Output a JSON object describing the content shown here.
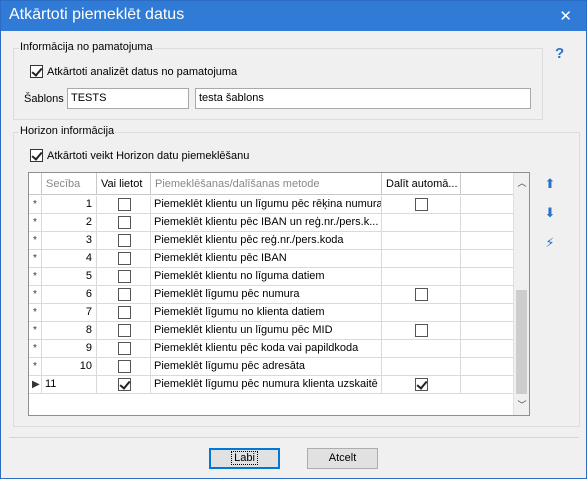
{
  "window": {
    "title": "Atkārtoti piemeklēt datus",
    "close_glyph": "✕"
  },
  "basis_group": {
    "caption": "Informācija no pamatojuma",
    "reanalyze_checkbox_label": "Atkārtoti analizēt datus no pamatojuma",
    "reanalyze_checked": true,
    "template_label": "Šablons",
    "template_code": "TESTS",
    "template_name": "testa šablons"
  },
  "horizon_group": {
    "caption": "Horizon informācija",
    "redo_checkbox_label": "Atkārtoti veikt Horizon datu piemeklēšanu",
    "redo_checked": true
  },
  "grid": {
    "columns": [
      "Secība",
      "Vai lietot",
      "Piemeklēšanas/dalīšanas metode",
      "Dalīt automā..."
    ],
    "rows": [
      {
        "indicator": "*",
        "order": "1",
        "use": false,
        "method": "Piemeklēt klientu un līgumu pēc rēķina numura",
        "split": false,
        "split_visible": true
      },
      {
        "indicator": "*",
        "order": "2",
        "use": false,
        "method": "Piemeklēt klientu pēc IBAN un reģ.nr./pers.k...",
        "split": false,
        "split_visible": false
      },
      {
        "indicator": "*",
        "order": "3",
        "use": false,
        "method": "Piemeklēt klientu pēc reģ.nr./pers.koda",
        "split": false,
        "split_visible": false
      },
      {
        "indicator": "*",
        "order": "4",
        "use": false,
        "method": "Piemeklēt klientu pēc IBAN",
        "split": false,
        "split_visible": false
      },
      {
        "indicator": "*",
        "order": "5",
        "use": false,
        "method": "Piemeklēt klientu no līguma datiem",
        "split": false,
        "split_visible": false
      },
      {
        "indicator": "*",
        "order": "6",
        "use": false,
        "method": "Piemeklēt līgumu pēc numura",
        "split": false,
        "split_visible": true
      },
      {
        "indicator": "*",
        "order": "7",
        "use": false,
        "method": "Piemeklēt līgumu no klienta datiem",
        "split": false,
        "split_visible": false
      },
      {
        "indicator": "*",
        "order": "8",
        "use": false,
        "method": "Piemeklēt klientu un līgumu pēc MID",
        "split": false,
        "split_visible": true
      },
      {
        "indicator": "*",
        "order": "9",
        "use": false,
        "method": "Piemeklēt klientu pēc koda vai papildkoda",
        "split": false,
        "split_visible": false
      },
      {
        "indicator": "*",
        "order": "10",
        "use": false,
        "method": "Piemeklēt līgumu pēc adresāta",
        "split": false,
        "split_visible": false
      },
      {
        "indicator": "▶",
        "order": "11",
        "use": true,
        "method": "Piemeklēt līgumu pēc numura klienta uzskaitē",
        "split": true,
        "split_visible": true
      }
    ]
  },
  "side_buttons": {
    "up_icon": "arrow-up-icon",
    "down_icon": "arrow-down-icon",
    "auto_icon": "lightning-icon"
  },
  "help_glyph": "?",
  "footer": {
    "ok_label": "Labi",
    "cancel_label": "Atcelt"
  }
}
